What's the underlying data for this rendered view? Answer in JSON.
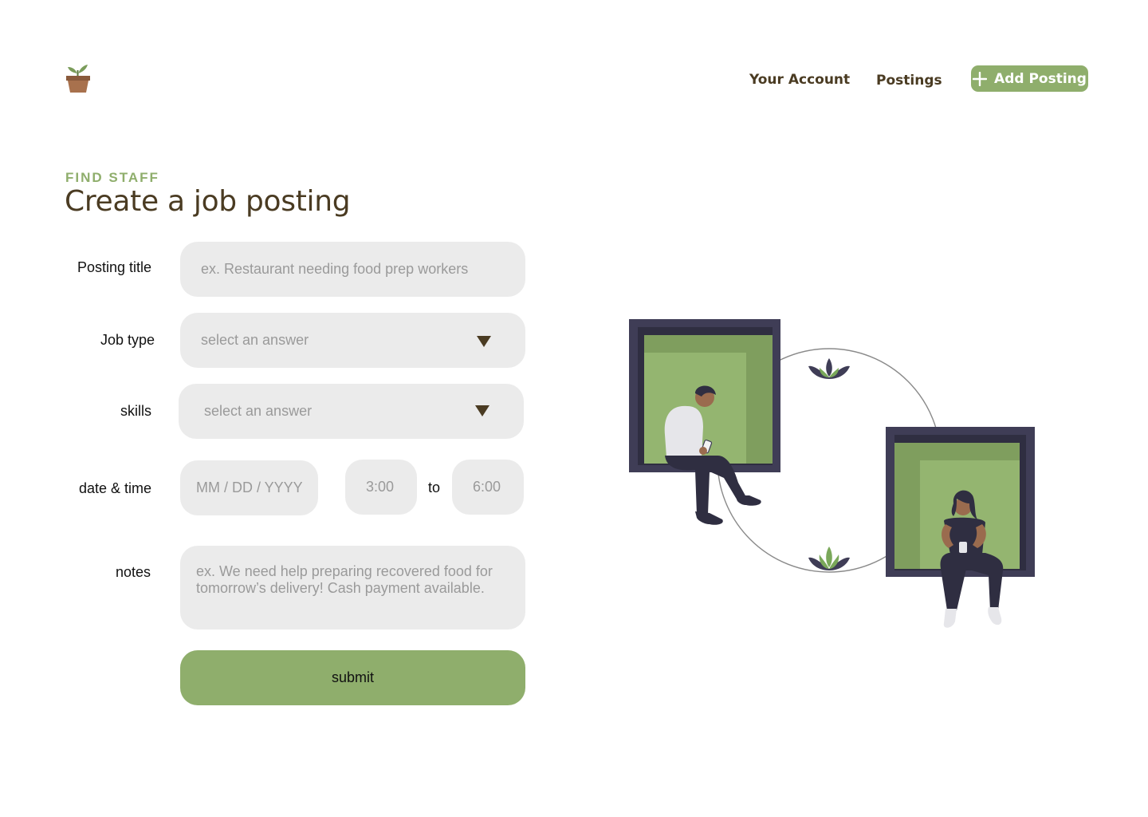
{
  "nav": {
    "your_account": "Your Account",
    "postings": "Postings",
    "add_posting": "Add Posting"
  },
  "header": {
    "eyebrow": "FIND STAFF",
    "title": "Create a job posting"
  },
  "form": {
    "posting_title": {
      "label": "Posting title",
      "placeholder": "ex. Restaurant needing food prep workers"
    },
    "job_type": {
      "label": "Job type",
      "placeholder": "select an answer"
    },
    "skills": {
      "label": "skills",
      "placeholder": "select an answer"
    },
    "date_time": {
      "label": "date & time",
      "date_placeholder": "MM / DD / YYYY",
      "start_placeholder": "3:00",
      "separator": "to",
      "end_placeholder": "6:00"
    },
    "notes": {
      "label": "notes",
      "placeholder": "ex. We need help preparing recovered food for tomorrow’s delivery! Cash payment available."
    },
    "submit": "submit"
  },
  "colors": {
    "accent": "#8fae6c",
    "brown": "#4a3b22",
    "field_bg": "#ebebeb",
    "frame_dark": "#3f3d56"
  },
  "icons": [
    "plant-pot-logo-icon",
    "plus-icon",
    "caret-down-icon"
  ]
}
